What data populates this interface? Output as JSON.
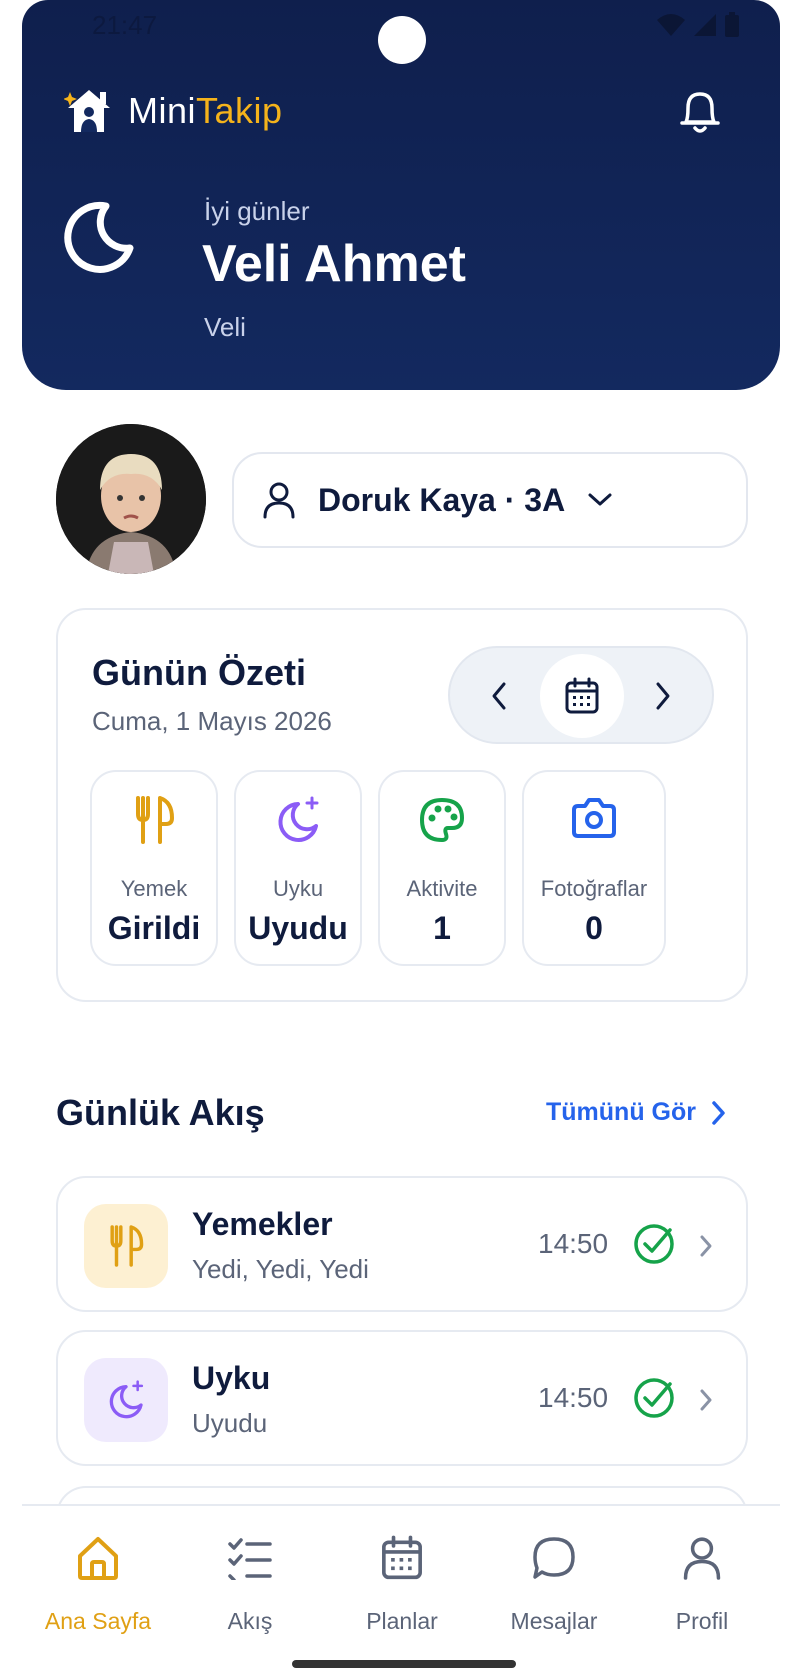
{
  "status_bar": {
    "time": "21:47"
  },
  "brand": {
    "name_prefix": "Mini",
    "name_accent": "Takip"
  },
  "colors": {
    "header_bg": "#13295f",
    "accent": "#f5b31b",
    "link": "#2563eb",
    "success": "#16a34a",
    "sleep": "#8b5cf6",
    "activity": "#16a34a",
    "photo": "#2563eb",
    "meal": "#e0a014"
  },
  "greeting": {
    "small": "İyi günler",
    "name": "Veli Ahmet",
    "role": "Veli"
  },
  "child_selector": {
    "label": "Doruk Kaya · 3A"
  },
  "summary": {
    "title": "Günün Özeti",
    "date": "Cuma, 1 Mayıs 2026",
    "stats": [
      {
        "icon": "fork-knife-icon",
        "label": "Yemek",
        "value": "Girildi"
      },
      {
        "icon": "moon-star-icon",
        "label": "Uyku",
        "value": "Uyudu"
      },
      {
        "icon": "palette-icon",
        "label": "Aktivite",
        "value": "1"
      },
      {
        "icon": "camera-icon",
        "label": "Fotoğraflar",
        "value": "0"
      }
    ]
  },
  "flow": {
    "title": "Günlük Akış",
    "see_all": "Tümünü Gör",
    "items": [
      {
        "icon": "fork-knife-icon",
        "name": "Yemekler",
        "sub": "Yedi, Yedi, Yedi",
        "time": "14:50",
        "done": true
      },
      {
        "icon": "moon-star-icon",
        "name": "Uyku",
        "sub": "Uyudu",
        "time": "14:50",
        "done": true
      }
    ]
  },
  "bottom_nav": {
    "items": [
      {
        "label": "Ana Sayfa",
        "icon": "home-icon",
        "active": true
      },
      {
        "label": "Akış",
        "icon": "checklist-icon",
        "active": false
      },
      {
        "label": "Planlar",
        "icon": "calendar-icon",
        "active": false
      },
      {
        "label": "Mesajlar",
        "icon": "chat-icon",
        "active": false
      },
      {
        "label": "Profil",
        "icon": "user-icon",
        "active": false
      }
    ]
  }
}
